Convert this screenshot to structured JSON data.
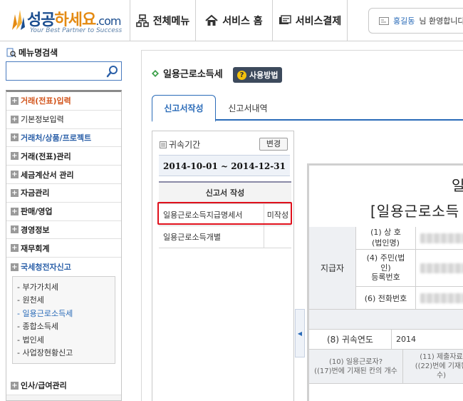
{
  "header": {
    "logo": {
      "brand_main": "성공",
      "brand_accent": "하세요",
      "brand_domain": ".com",
      "slogan": "Your Best Partner to Success",
      "colors": {
        "primary": "#1a4d8f",
        "accent": "#e48a12"
      }
    },
    "nav": [
      {
        "label": "전체메뉴",
        "icon": "sitemap-icon"
      },
      {
        "label": "서비스 홈",
        "icon": "home-icon"
      },
      {
        "label": "서비스결제",
        "icon": "payment-icon"
      }
    ],
    "welcome": {
      "user": "홍길동",
      "suffix": "님 환영합니다"
    }
  },
  "sidebar": {
    "search_label": "메뉴명검색",
    "search_value": "",
    "menu": [
      {
        "label": "거래(전표)입력",
        "style": "orange"
      },
      {
        "label": "기본정보입력",
        "style": "normal"
      },
      {
        "label": "거래처/상품/프로젝트",
        "style": "blue"
      },
      {
        "label": "거래(전표)관리",
        "style": "bold"
      },
      {
        "label": "세금계산서 관리",
        "style": "bold"
      },
      {
        "label": "자금관리",
        "style": "bold"
      },
      {
        "label": "판매/영업",
        "style": "bold"
      },
      {
        "label": "경영정보",
        "style": "bold"
      },
      {
        "label": "재무회계",
        "style": "bold"
      },
      {
        "label": "국세청전자신고",
        "style": "blue"
      }
    ],
    "submenu": [
      {
        "label": "- 부가가치세"
      },
      {
        "label": "- 원천세"
      },
      {
        "label": "- 일용근로소득세",
        "active": true
      },
      {
        "label": "- 종합소득세"
      },
      {
        "label": "- 법인세"
      },
      {
        "label": "- 사업장현황신고"
      }
    ],
    "menu_after": [
      {
        "label": "인사/급여관리",
        "style": "bold"
      }
    ]
  },
  "main": {
    "title": "일용근로소득세",
    "usage_button": "사용방법",
    "tabs": [
      {
        "label": "신고서작성",
        "active": true
      },
      {
        "label": "신고서내역",
        "active": false
      }
    ],
    "period": {
      "label": "귀속기간",
      "change_button": "변경",
      "value": "2014-10-01 ~ 2014-12-31"
    },
    "form_table": {
      "header": "신고서 작성",
      "rows": [
        {
          "name": "일용근로소득지급명세서",
          "status": "미작성",
          "highlighted": true
        },
        {
          "name": "일용근로소득개별",
          "status": ""
        }
      ]
    },
    "document": {
      "title_line1": "일",
      "title_line2": "[일용근로소득",
      "section_payer": "지급자",
      "fields": [
        {
          "label": "(1) 상 호\n(법인명)"
        },
        {
          "label": "(4) 주민(법\n인)\n등록번호"
        },
        {
          "label": "(6) 전화번호"
        }
      ],
      "year_label": "(8) 귀속연도",
      "year_value": "2014",
      "col10": "(10) 일용근로자?\n((17)번에 기재된 칸의 개수",
      "col11": "(11) 제출자료\n((22)번에 기재된\n수)"
    },
    "highlight_color": "#e0101c"
  }
}
